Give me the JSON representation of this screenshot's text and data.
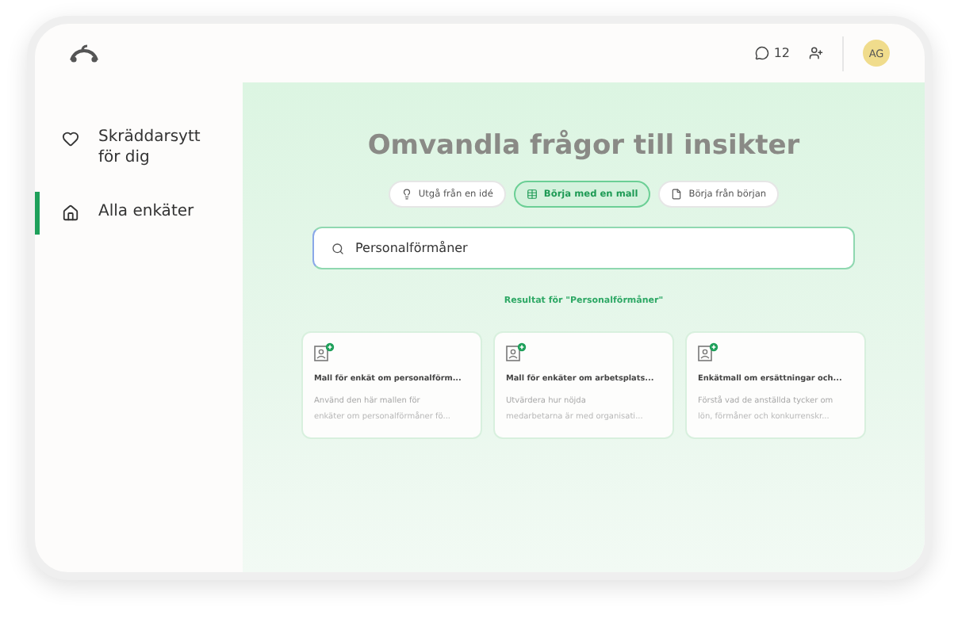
{
  "header": {
    "comments_count": "12",
    "avatar": "AG"
  },
  "sidebar": {
    "items": [
      {
        "label": "Skräddarsytt för dig",
        "selected": false
      },
      {
        "label": "Alla enkäter",
        "selected": true
      }
    ]
  },
  "main": {
    "title": "Omvandla frågor till insikter",
    "tabs": [
      {
        "label": "Utgå från en idé",
        "selected": false
      },
      {
        "label": "Börja med en mall",
        "selected": true
      },
      {
        "label": "Börja från början",
        "selected": false
      }
    ],
    "search": {
      "value": "Personalförmåner"
    },
    "results_label": "Resultat för \"Personalförmåner\"",
    "cards": [
      {
        "title": "Mall för enkät om personalförm...",
        "lines": [
          "Använd den här mallen för",
          "enkäter om personalförmåner fö..."
        ]
      },
      {
        "title": "Mall för enkäter om arbetsplats...",
        "lines": [
          "Utvärdera hur nöjda",
          "medarbetarna är med organisati..."
        ]
      },
      {
        "title": "Enkätmall om ersättningar och...",
        "lines": [
          "Förstå vad de anställda tycker om",
          "lön, förmåner och konkurrenskr..."
        ]
      }
    ]
  }
}
